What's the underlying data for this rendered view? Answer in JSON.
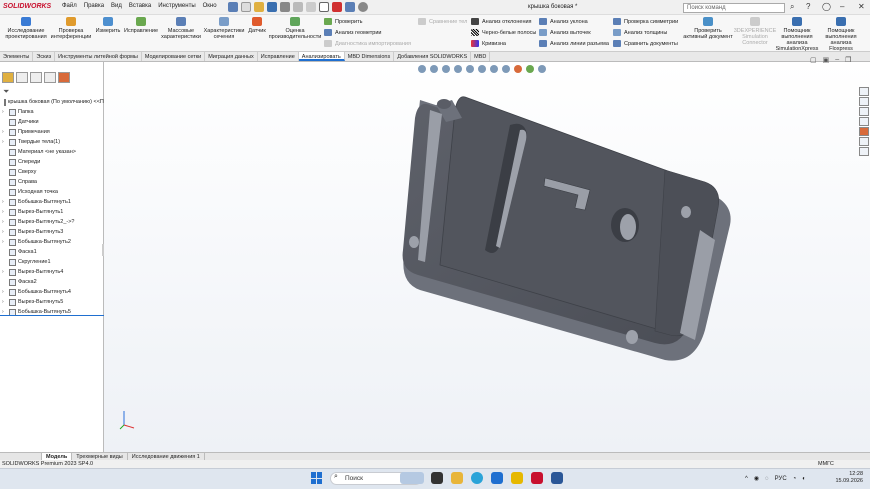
{
  "app": {
    "logo": "SOLIDWORKS",
    "doc_title": "крышка боковая *",
    "search_placeholder": "Поиск команд"
  },
  "menu": [
    "Файл",
    "Правка",
    "Вид",
    "Вставка",
    "Инструменты",
    "Окно"
  ],
  "ribbon_big": [
    {
      "label": "Исследование проектирования",
      "icon": "study-icon",
      "color": "#3a7bd5"
    },
    {
      "label": "Проверка интерференции",
      "icon": "interference-icon",
      "color": "#e09b2d"
    },
    {
      "label": "Измерить",
      "icon": "measure-icon",
      "color": "#4d8fcf"
    },
    {
      "label": "Исправление",
      "icon": "repair-icon",
      "color": "#6aa84f"
    },
    {
      "label": "Массовые характеристики",
      "icon": "mass-icon",
      "color": "#5b7fb6"
    },
    {
      "label": "Характеристики сечения",
      "icon": "section-icon",
      "color": "#7a9dc8"
    },
    {
      "label": "Датчик",
      "icon": "sensor-icon",
      "color": "#e05b2d"
    },
    {
      "label": "Оценка производительности",
      "icon": "performance-icon",
      "color": "#5fa55a"
    }
  ],
  "ribbon_small_col1": [
    "Проверить",
    "Анализ геометрии",
    "Диагностика импортирования"
  ],
  "ribbon_small_col2": [
    "Сравнение тел"
  ],
  "ribbon_small_col3": [
    "Анализ отклонения",
    "Черно-белые полосы",
    "Кривизна"
  ],
  "ribbon_small_col4": [
    "Анализ уклона",
    "Анализ выточек",
    "Анализ линии разъема"
  ],
  "ribbon_small_col5": [
    "Проверка симметрии",
    "Анализ толщины",
    "Сравнить документы"
  ],
  "ribbon_right": [
    {
      "label": "Проверить активный документ",
      "color": "#4a90c8"
    },
    {
      "label": "3DEXPERIENCE Simulation Connector",
      "color": "#aaaaaa"
    },
    {
      "label": "Помощник выполнения анализа SimulationXpress",
      "color": "#3a6fb0"
    },
    {
      "label": "Помощник выполнения анализа Floxpress",
      "color": "#3a6fb0"
    }
  ],
  "tabs": [
    "Элементы",
    "Эскиз",
    "Инструменты литейной формы",
    "Моделирование сетки",
    "Миграция данных",
    "Исправление",
    "Анализировать",
    "MBD Dimensions",
    "Добавления SOLIDWORKS",
    "MBD"
  ],
  "active_tab": "Анализировать",
  "tree": [
    {
      "label": "крышка боковая (По умолчанию) <<По у",
      "arrow": ""
    },
    {
      "label": "Папка",
      "arrow": "›"
    },
    {
      "label": "Датчики",
      "arrow": ""
    },
    {
      "label": "Примечания",
      "arrow": "›"
    },
    {
      "label": "Твердые тела(1)",
      "arrow": "›"
    },
    {
      "label": "Материал <не указан>",
      "arrow": ""
    },
    {
      "label": "Спереди",
      "arrow": ""
    },
    {
      "label": "Сверху",
      "arrow": ""
    },
    {
      "label": "Справа",
      "arrow": ""
    },
    {
      "label": "Исходная точка",
      "arrow": ""
    },
    {
      "label": "Бобышка-Вытянуть1",
      "arrow": "›"
    },
    {
      "label": "Вырез-Вытянуть1",
      "arrow": "›"
    },
    {
      "label": "Вырез-Вытянуть2_->?",
      "arrow": "›"
    },
    {
      "label": "Вырез-Вытянуть3",
      "arrow": "›"
    },
    {
      "label": "Бобышка-Вытянуть2",
      "arrow": "›"
    },
    {
      "label": "Фаска1",
      "arrow": ""
    },
    {
      "label": "Скругление1",
      "arrow": ""
    },
    {
      "label": "Вырез-Вытянуть4",
      "arrow": "›"
    },
    {
      "label": "Фаска2",
      "arrow": ""
    },
    {
      "label": "Бобышка-Вытянуть4",
      "arrow": "›"
    },
    {
      "label": "Вырез-Вытянуть5",
      "arrow": "›"
    },
    {
      "label": "Бобышка-Вытянуть5",
      "arrow": "›"
    }
  ],
  "bottom_tabs": [
    "Модель",
    "Трехмерные виды",
    "Исследование движения 1"
  ],
  "status": {
    "left": "SOLIDWORKS Premium 2023 SP4.0",
    "units": "ММГС"
  },
  "taskbar": {
    "search": "Поиск",
    "lang": "РУС",
    "time": "12:28",
    "date": "15.09.2026"
  },
  "model": {
    "body_color": "#5a5d66",
    "face_color": "#4c4f57",
    "side_color": "#6d717b"
  }
}
